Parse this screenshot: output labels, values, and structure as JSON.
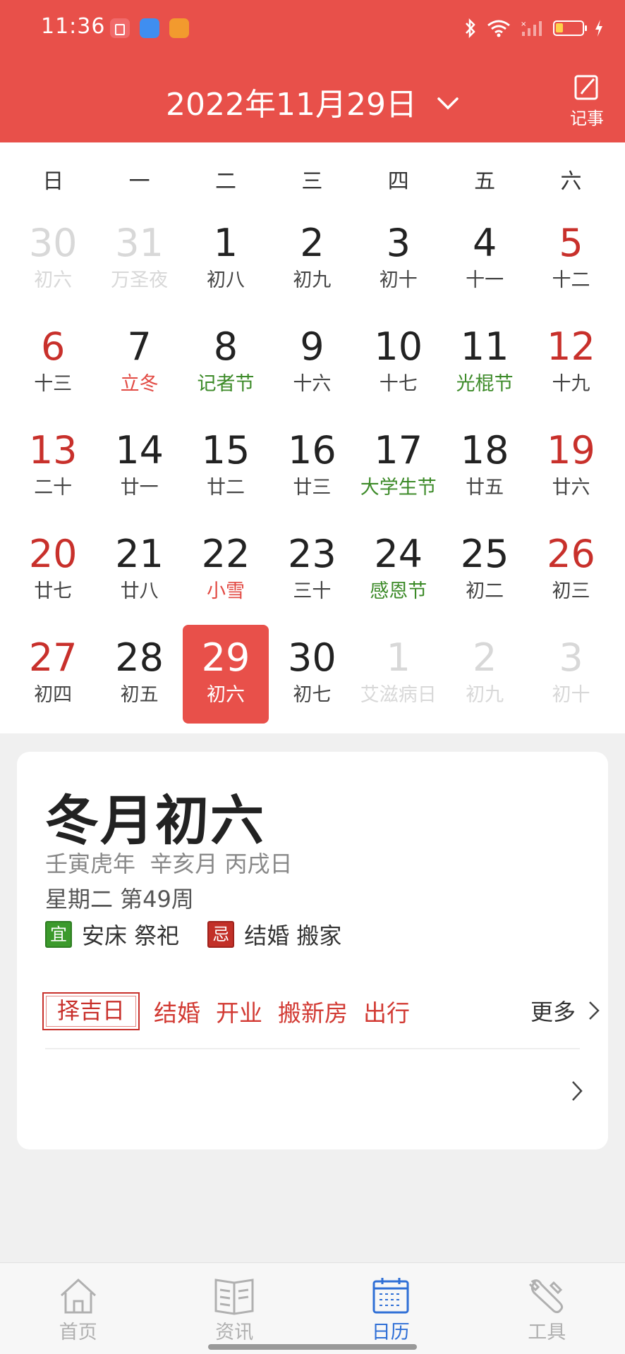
{
  "status_bar": {
    "time": "11:36"
  },
  "header": {
    "date_title": "2022年11月29日",
    "note_label": "记事"
  },
  "weekdays": [
    "日",
    "一",
    "二",
    "三",
    "四",
    "五",
    "六"
  ],
  "weeks": [
    [
      {
        "num": "30",
        "sub": "初六",
        "dim": true
      },
      {
        "num": "31",
        "sub": "万圣夜",
        "dim": true
      },
      {
        "num": "1",
        "sub": "初八"
      },
      {
        "num": "2",
        "sub": "初九"
      },
      {
        "num": "3",
        "sub": "初十"
      },
      {
        "num": "4",
        "sub": "十一"
      },
      {
        "num": "5",
        "sub": "十二",
        "weekend": true
      }
    ],
    [
      {
        "num": "6",
        "sub": "十三",
        "weekend": true
      },
      {
        "num": "7",
        "sub": "立冬",
        "subColor": "red"
      },
      {
        "num": "8",
        "sub": "记者节",
        "subColor": "green"
      },
      {
        "num": "9",
        "sub": "十六"
      },
      {
        "num": "10",
        "sub": "十七"
      },
      {
        "num": "11",
        "sub": "光棍节",
        "subColor": "green"
      },
      {
        "num": "12",
        "sub": "十九",
        "weekend": true
      }
    ],
    [
      {
        "num": "13",
        "sub": "二十",
        "weekend": true
      },
      {
        "num": "14",
        "sub": "廿一"
      },
      {
        "num": "15",
        "sub": "廿二"
      },
      {
        "num": "16",
        "sub": "廿三"
      },
      {
        "num": "17",
        "sub": "大学生节",
        "subColor": "green"
      },
      {
        "num": "18",
        "sub": "廿五"
      },
      {
        "num": "19",
        "sub": "廿六",
        "weekend": true
      }
    ],
    [
      {
        "num": "20",
        "sub": "廿七",
        "weekend": true
      },
      {
        "num": "21",
        "sub": "廿八"
      },
      {
        "num": "22",
        "sub": "小雪",
        "subColor": "red"
      },
      {
        "num": "23",
        "sub": "三十"
      },
      {
        "num": "24",
        "sub": "感恩节",
        "subColor": "green"
      },
      {
        "num": "25",
        "sub": "初二"
      },
      {
        "num": "26",
        "sub": "初三",
        "weekend": true
      }
    ],
    [
      {
        "num": "27",
        "sub": "初四",
        "weekend": true
      },
      {
        "num": "28",
        "sub": "初五"
      },
      {
        "num": "29",
        "sub": "初六",
        "selected": true
      },
      {
        "num": "30",
        "sub": "初七"
      },
      {
        "num": "1",
        "sub": "艾滋病日",
        "dim": true
      },
      {
        "num": "2",
        "sub": "初九",
        "dim": true
      },
      {
        "num": "3",
        "sub": "初十",
        "dim": true
      }
    ]
  ],
  "card": {
    "lunar_title": "冬月初六",
    "ganzhi": "壬寅虎年  辛亥月 丙戌日",
    "week_info": "星期二 第49周",
    "yi_tag": "宜",
    "yi_text": "安床 祭祀",
    "ji_tag": "忌",
    "ji_text": "结婚 搬家",
    "zeji_badge": "择吉日",
    "zeji_items": [
      "结婚",
      "开业",
      "搬新房",
      "出行"
    ],
    "more_label": "更多"
  },
  "nav": [
    {
      "label": "首页",
      "icon": "home-icon"
    },
    {
      "label": "资讯",
      "icon": "news-icon"
    },
    {
      "label": "日历",
      "icon": "calendar-icon",
      "active": true
    },
    {
      "label": "工具",
      "icon": "tools-icon"
    }
  ],
  "colors": {
    "header_red": "#e8504a",
    "weekend_red": "#c8302b",
    "festival_green": "#3c8a28",
    "term_red": "#e24a43",
    "nav_active_blue": "#2f6fd6"
  }
}
